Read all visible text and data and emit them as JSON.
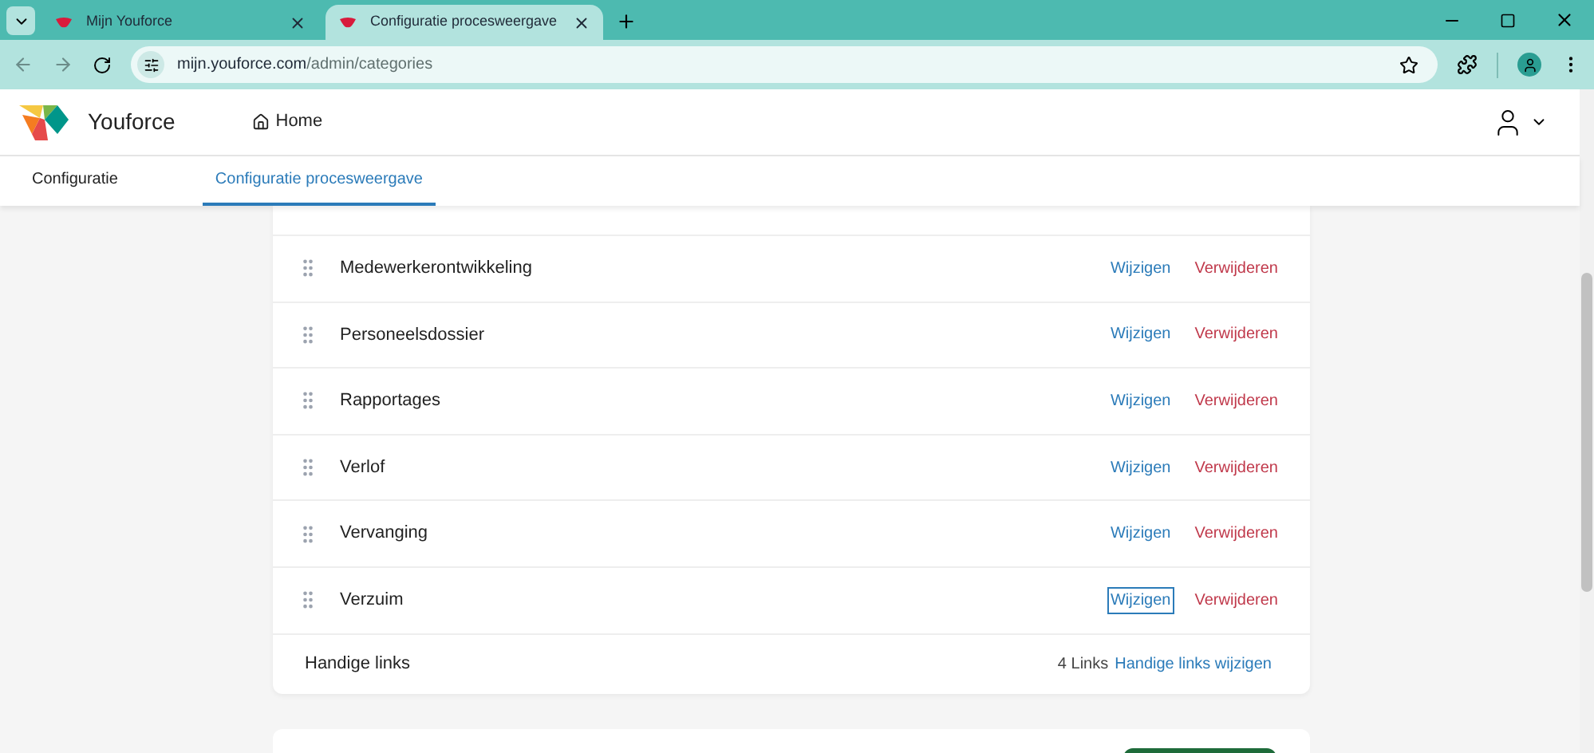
{
  "browser": {
    "tabs": [
      {
        "title": "Mijn Youforce",
        "selected": false
      },
      {
        "title": "Configuratie procesweergave",
        "selected": true
      }
    ],
    "url_host": "mijn.youforce.com",
    "url_path": "/admin/categories"
  },
  "header": {
    "brand": "Youforce",
    "home": "Home"
  },
  "subnav": [
    {
      "label": "Configuratie",
      "selected": false
    },
    {
      "label": "Configuratie procesweergave",
      "selected": true
    }
  ],
  "categories": [
    {
      "name": "Medewerkerontwikkeling",
      "edit": "Wijzigen",
      "delete": "Verwijderen",
      "focused": false
    },
    {
      "name": "Personeelsdossier",
      "edit": "Wijzigen",
      "delete": "Verwijderen",
      "focused": false
    },
    {
      "name": "Rapportages",
      "edit": "Wijzigen",
      "delete": "Verwijderen",
      "focused": false
    },
    {
      "name": "Verlof",
      "edit": "Wijzigen",
      "delete": "Verwijderen",
      "focused": false
    },
    {
      "name": "Vervanging",
      "edit": "Wijzigen",
      "delete": "Verwijderen",
      "focused": false
    },
    {
      "name": "Verzuim",
      "edit": "Wijzigen",
      "delete": "Verwijderen",
      "focused": true
    }
  ],
  "links_row": {
    "label": "Handige links",
    "count": "4 Links",
    "action": "Handige links wijzigen"
  }
}
